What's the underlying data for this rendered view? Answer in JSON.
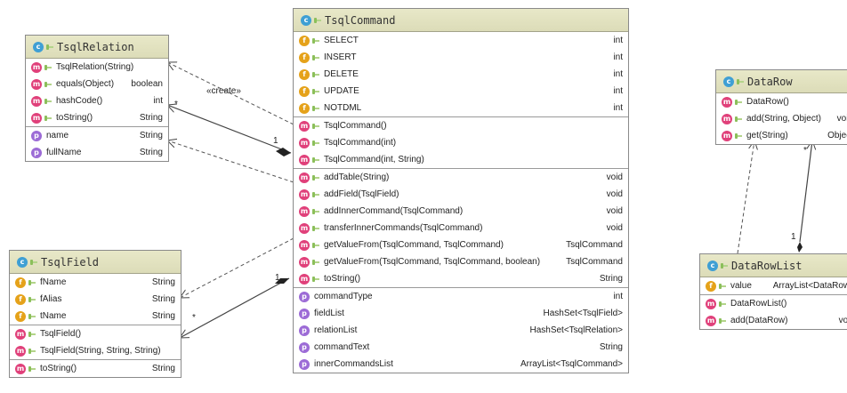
{
  "classes": {
    "tsql_relation": {
      "title": "TsqlRelation",
      "methods": [
        {
          "name": "TsqlRelation(String)",
          "type": ""
        },
        {
          "name": "equals(Object)",
          "type": "boolean"
        },
        {
          "name": "hashCode()",
          "type": "int"
        },
        {
          "name": "toString()",
          "type": "String"
        }
      ],
      "properties": [
        {
          "name": "name",
          "type": "String"
        },
        {
          "name": "fullName",
          "type": "String"
        }
      ]
    },
    "tsql_field": {
      "title": "TsqlField",
      "fields": [
        {
          "name": "fName",
          "type": "String"
        },
        {
          "name": "fAlias",
          "type": "String"
        },
        {
          "name": "tName",
          "type": "String"
        }
      ],
      "constructors": [
        {
          "name": "TsqlField()",
          "type": ""
        },
        {
          "name": "TsqlField(String, String, String)",
          "type": ""
        }
      ],
      "methods": [
        {
          "name": "toString()",
          "type": "String"
        }
      ]
    },
    "tsql_command": {
      "title": "TsqlCommand",
      "fields": [
        {
          "name": "SELECT",
          "type": "int"
        },
        {
          "name": "INSERT",
          "type": "int"
        },
        {
          "name": "DELETE",
          "type": "int"
        },
        {
          "name": "UPDATE",
          "type": "int"
        },
        {
          "name": "NOTDML",
          "type": "int"
        }
      ],
      "constructors": [
        {
          "name": "TsqlCommand()",
          "type": ""
        },
        {
          "name": "TsqlCommand(int)",
          "type": ""
        },
        {
          "name": "TsqlCommand(int, String)",
          "type": ""
        }
      ],
      "methods": [
        {
          "name": "addTable(String)",
          "type": "void"
        },
        {
          "name": "addField(TsqlField)",
          "type": "void"
        },
        {
          "name": "addInnerCommand(TsqlCommand)",
          "type": "void"
        },
        {
          "name": "transferInnerCommands(TsqlCommand)",
          "type": "void"
        },
        {
          "name": "getValueFrom(TsqlCommand, TsqlCommand)",
          "type": "TsqlCommand"
        },
        {
          "name": "getValueFrom(TsqlCommand, TsqlCommand, boolean)",
          "type": "TsqlCommand"
        },
        {
          "name": "toString()",
          "type": "String"
        }
      ],
      "properties": [
        {
          "name": "commandType",
          "type": "int"
        },
        {
          "name": "fieldList",
          "type": "HashSet<TsqlField>"
        },
        {
          "name": "relationList",
          "type": "HashSet<TsqlRelation>"
        },
        {
          "name": "commandText",
          "type": "String"
        },
        {
          "name": "innerCommandsList",
          "type": "ArrayList<TsqlCommand>"
        }
      ]
    },
    "data_row": {
      "title": "DataRow",
      "methods": [
        {
          "name": "DataRow()",
          "type": ""
        },
        {
          "name": "add(String, Object)",
          "type": "void"
        },
        {
          "name": "get(String)",
          "type": "Object"
        }
      ]
    },
    "data_row_list": {
      "title": "DataRowList",
      "fields": [
        {
          "name": "value",
          "type": "ArrayList<DataRow>"
        }
      ],
      "methods": [
        {
          "name": "DataRowList()",
          "type": ""
        },
        {
          "name": "add(DataRow)",
          "type": "void"
        }
      ]
    }
  },
  "relations": {
    "create_label": "«create»",
    "star": "*",
    "one": "1"
  },
  "badges": {
    "class": "c",
    "method": "m",
    "field": "f",
    "property": "p"
  }
}
